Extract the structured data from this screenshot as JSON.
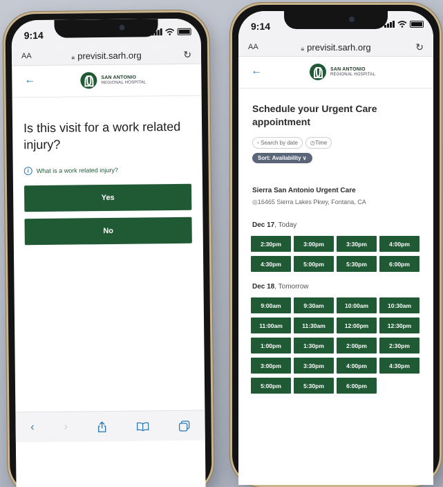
{
  "left_phone": {
    "status": {
      "time": "9:14"
    },
    "address": {
      "aa": "AA",
      "url": "previsit.sarh.org"
    },
    "logo": {
      "line1": "SAN ANTONIO",
      "line2": "REGIONAL HOSPITAL"
    },
    "question": "Is this visit for a work related injury?",
    "info_link": "What is a work related injury?",
    "options": [
      {
        "label": "Yes"
      },
      {
        "label": "No"
      }
    ]
  },
  "right_phone": {
    "status": {
      "time": "9:14"
    },
    "address": {
      "aa": "AA",
      "url": "previsit.sarh.org"
    },
    "logo": {
      "line1": "SAN ANTONIO",
      "line2": "REGIONAL HOSPITAL"
    },
    "title": "Schedule your Urgent Care appointment",
    "filters": {
      "search_by_date": "Search by date",
      "time": "Time",
      "sort": "Sort: Availability"
    },
    "location": {
      "name": "Sierra San Antonio Urgent Care",
      "address": "16465 Sierra Lakes Pkwy, Fontana, CA"
    },
    "days": [
      {
        "date": "Dec 17",
        "relative": ", Today",
        "slots": [
          "2:30pm",
          "3:00pm",
          "3:30pm",
          "4:00pm",
          "4:30pm",
          "5:00pm",
          "5:30pm",
          "6:00pm"
        ]
      },
      {
        "date": "Dec 18",
        "relative": ", Tomorrow",
        "slots": [
          "9:00am",
          "9:30am",
          "10:00am",
          "10:30am",
          "11:00am",
          "11:30am",
          "12:00pm",
          "12:30pm",
          "1:00pm",
          "1:30pm",
          "2:00pm",
          "2:30pm",
          "3:00pm",
          "3:30pm",
          "4:00pm",
          "4:30pm",
          "5:00pm",
          "5:30pm",
          "6:00pm"
        ]
      }
    ]
  },
  "colors": {
    "brand_green": "#1f5a35",
    "link_blue": "#2a7ab8",
    "frame_gold": "#c9b48e",
    "sort_chip": "#5b6578"
  }
}
